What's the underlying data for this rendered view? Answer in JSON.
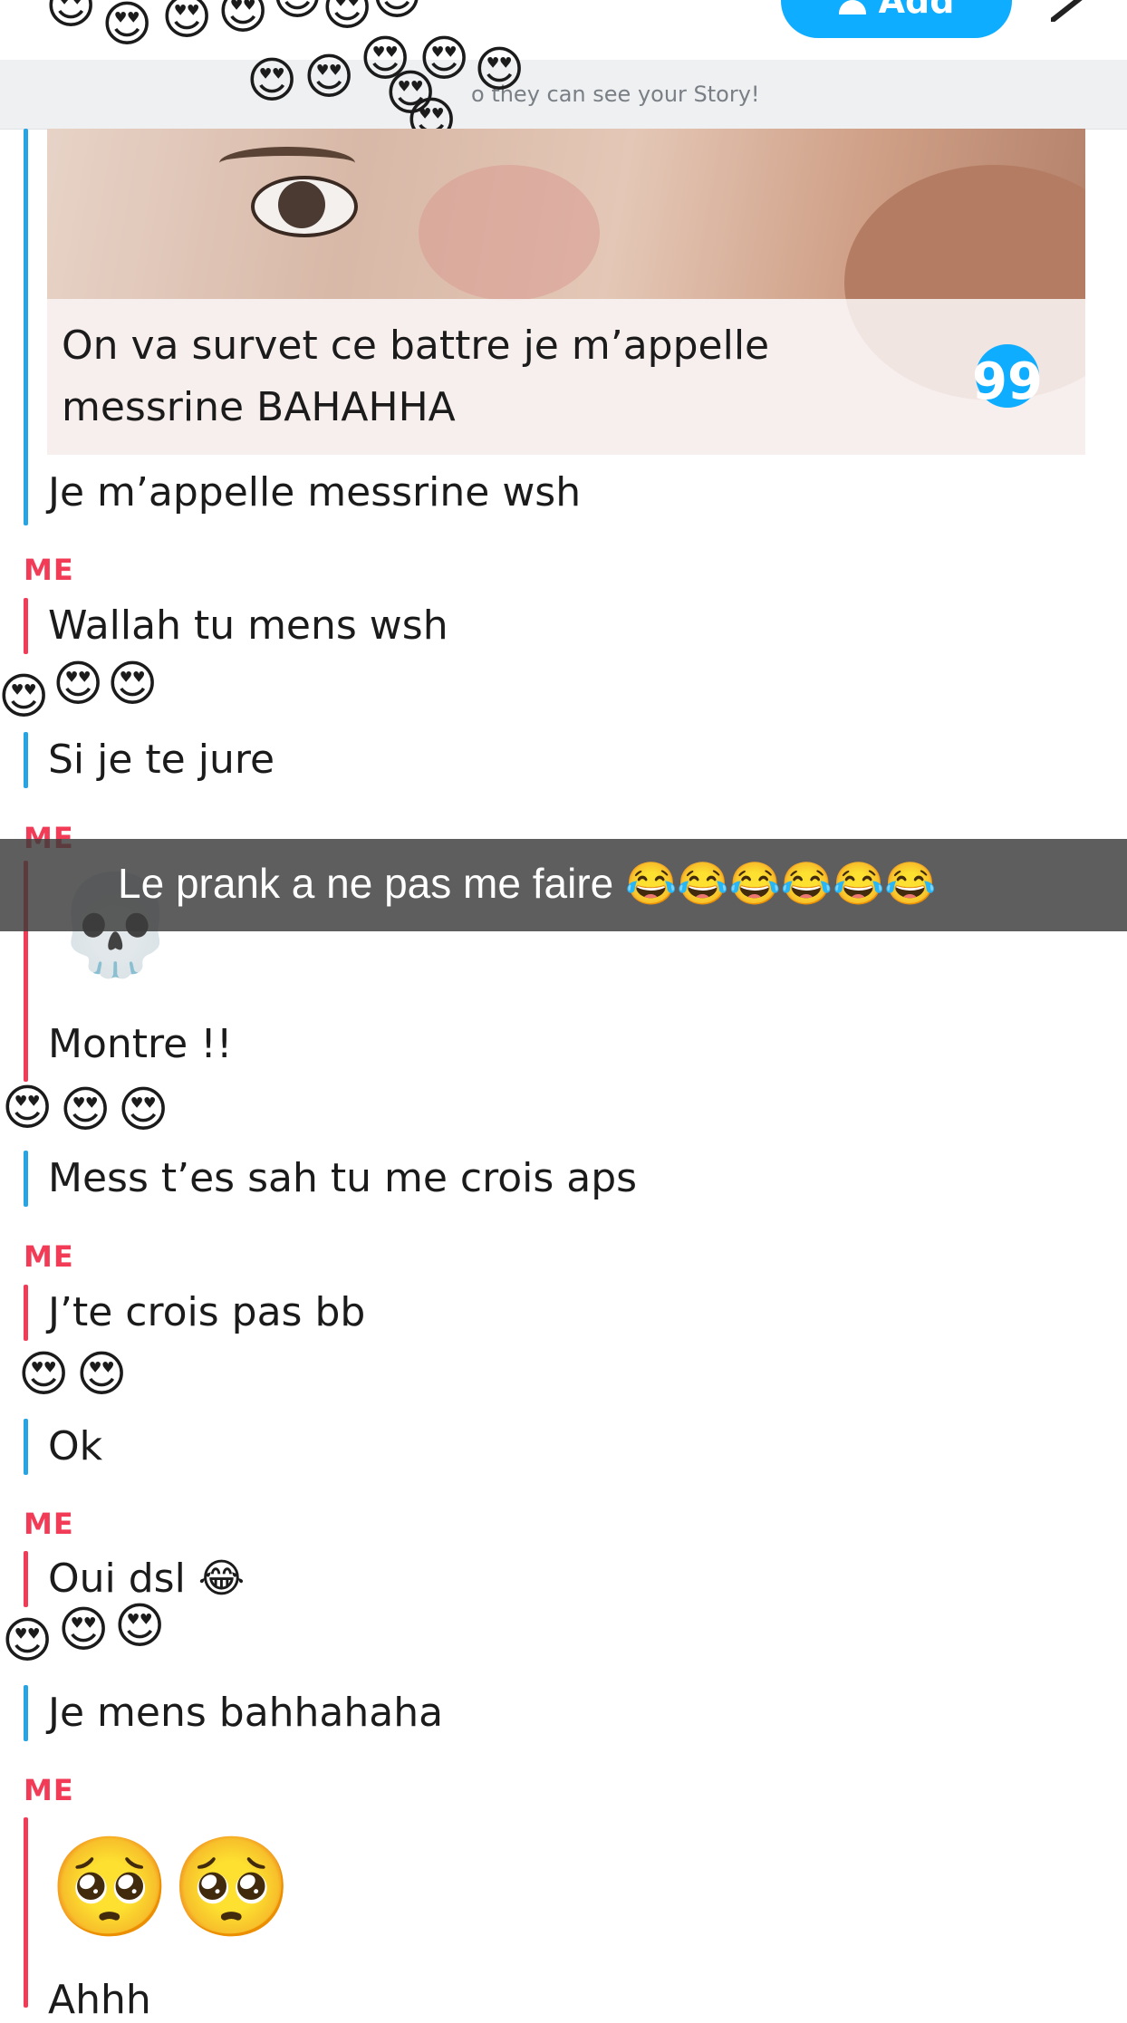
{
  "header": {
    "add_label": "Add",
    "story_banner": "o they can see your Story!",
    "icons": [
      "add-friend-icon",
      "pencil-icon"
    ]
  },
  "quote": {
    "line1": "On va survet ce battre je m’appelle",
    "line2": "messrine BAHAHHA",
    "icon_glyph": "99"
  },
  "messages": [
    {
      "sender": "friend",
      "text": "Je m’appelle messrine wsh"
    },
    {
      "sender": "me",
      "label": "ME",
      "text": "Wallah tu mens wsh"
    },
    {
      "sender": "friend",
      "text": "Si je te jure"
    },
    {
      "sender": "me",
      "label": "ME",
      "emoji": "💀",
      "text": "Montre !!"
    },
    {
      "sender": "friend",
      "text": "Mess t’es sah tu me crois aps"
    },
    {
      "sender": "me",
      "label": "ME",
      "text": "J’te crois pas bb"
    },
    {
      "sender": "friend",
      "text": "Ok"
    },
    {
      "sender": "me",
      "label": "ME",
      "text": "Oui dsl 😂"
    },
    {
      "sender": "friend",
      "text": "Je mens bahhahaha"
    },
    {
      "sender": "me",
      "label": "ME",
      "emoji": "🥺🥺",
      "text": "Ahhh"
    }
  ],
  "overlay_caption": "Le prank a ne pas me faire 😂😂😂😂😂😂",
  "sticker_emoji": "😍",
  "colors": {
    "me_accent": "#f23c57",
    "friend_accent": "#26a5e4",
    "add_button": "#0fadff"
  }
}
